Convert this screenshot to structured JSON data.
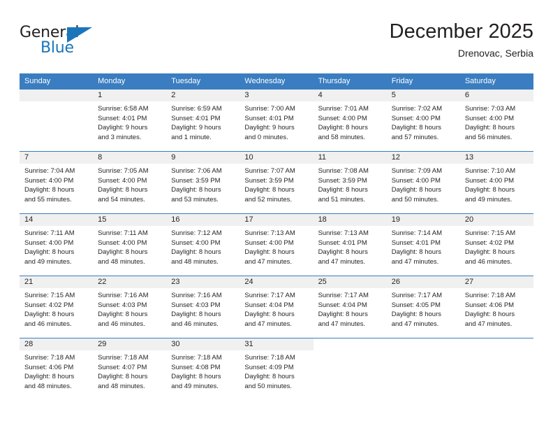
{
  "brand": {
    "name_top": "General",
    "name_bottom": "Blue",
    "accent_color": "#1b75bb",
    "flag_icon": "triangle-flag-icon"
  },
  "header": {
    "title": "December 2025",
    "subtitle": "Drenovac, Serbia"
  },
  "theme": {
    "header_row_bg": "#3a7dc0",
    "daynum_band_bg": "#f0f0f0",
    "text_color": "#231f20"
  },
  "weekdays": [
    "Sunday",
    "Monday",
    "Tuesday",
    "Wednesday",
    "Thursday",
    "Friday",
    "Saturday"
  ],
  "weeks": [
    [
      {
        "day": "",
        "empty": true,
        "sunrise": "",
        "sunset": "",
        "daylight_line1": "",
        "daylight_line2": ""
      },
      {
        "day": "1",
        "sunrise": "Sunrise: 6:58 AM",
        "sunset": "Sunset: 4:01 PM",
        "daylight_line1": "Daylight: 9 hours",
        "daylight_line2": "and 3 minutes."
      },
      {
        "day": "2",
        "sunrise": "Sunrise: 6:59 AM",
        "sunset": "Sunset: 4:01 PM",
        "daylight_line1": "Daylight: 9 hours",
        "daylight_line2": "and 1 minute."
      },
      {
        "day": "3",
        "sunrise": "Sunrise: 7:00 AM",
        "sunset": "Sunset: 4:01 PM",
        "daylight_line1": "Daylight: 9 hours",
        "daylight_line2": "and 0 minutes."
      },
      {
        "day": "4",
        "sunrise": "Sunrise: 7:01 AM",
        "sunset": "Sunset: 4:00 PM",
        "daylight_line1": "Daylight: 8 hours",
        "daylight_line2": "and 58 minutes."
      },
      {
        "day": "5",
        "sunrise": "Sunrise: 7:02 AM",
        "sunset": "Sunset: 4:00 PM",
        "daylight_line1": "Daylight: 8 hours",
        "daylight_line2": "and 57 minutes."
      },
      {
        "day": "6",
        "sunrise": "Sunrise: 7:03 AM",
        "sunset": "Sunset: 4:00 PM",
        "daylight_line1": "Daylight: 8 hours",
        "daylight_line2": "and 56 minutes."
      }
    ],
    [
      {
        "day": "7",
        "sunrise": "Sunrise: 7:04 AM",
        "sunset": "Sunset: 4:00 PM",
        "daylight_line1": "Daylight: 8 hours",
        "daylight_line2": "and 55 minutes."
      },
      {
        "day": "8",
        "sunrise": "Sunrise: 7:05 AM",
        "sunset": "Sunset: 4:00 PM",
        "daylight_line1": "Daylight: 8 hours",
        "daylight_line2": "and 54 minutes."
      },
      {
        "day": "9",
        "sunrise": "Sunrise: 7:06 AM",
        "sunset": "Sunset: 3:59 PM",
        "daylight_line1": "Daylight: 8 hours",
        "daylight_line2": "and 53 minutes."
      },
      {
        "day": "10",
        "sunrise": "Sunrise: 7:07 AM",
        "sunset": "Sunset: 3:59 PM",
        "daylight_line1": "Daylight: 8 hours",
        "daylight_line2": "and 52 minutes."
      },
      {
        "day": "11",
        "sunrise": "Sunrise: 7:08 AM",
        "sunset": "Sunset: 3:59 PM",
        "daylight_line1": "Daylight: 8 hours",
        "daylight_line2": "and 51 minutes."
      },
      {
        "day": "12",
        "sunrise": "Sunrise: 7:09 AM",
        "sunset": "Sunset: 4:00 PM",
        "daylight_line1": "Daylight: 8 hours",
        "daylight_line2": "and 50 minutes."
      },
      {
        "day": "13",
        "sunrise": "Sunrise: 7:10 AM",
        "sunset": "Sunset: 4:00 PM",
        "daylight_line1": "Daylight: 8 hours",
        "daylight_line2": "and 49 minutes."
      }
    ],
    [
      {
        "day": "14",
        "sunrise": "Sunrise: 7:11 AM",
        "sunset": "Sunset: 4:00 PM",
        "daylight_line1": "Daylight: 8 hours",
        "daylight_line2": "and 49 minutes."
      },
      {
        "day": "15",
        "sunrise": "Sunrise: 7:11 AM",
        "sunset": "Sunset: 4:00 PM",
        "daylight_line1": "Daylight: 8 hours",
        "daylight_line2": "and 48 minutes."
      },
      {
        "day": "16",
        "sunrise": "Sunrise: 7:12 AM",
        "sunset": "Sunset: 4:00 PM",
        "daylight_line1": "Daylight: 8 hours",
        "daylight_line2": "and 48 minutes."
      },
      {
        "day": "17",
        "sunrise": "Sunrise: 7:13 AM",
        "sunset": "Sunset: 4:00 PM",
        "daylight_line1": "Daylight: 8 hours",
        "daylight_line2": "and 47 minutes."
      },
      {
        "day": "18",
        "sunrise": "Sunrise: 7:13 AM",
        "sunset": "Sunset: 4:01 PM",
        "daylight_line1": "Daylight: 8 hours",
        "daylight_line2": "and 47 minutes."
      },
      {
        "day": "19",
        "sunrise": "Sunrise: 7:14 AM",
        "sunset": "Sunset: 4:01 PM",
        "daylight_line1": "Daylight: 8 hours",
        "daylight_line2": "and 47 minutes."
      },
      {
        "day": "20",
        "sunrise": "Sunrise: 7:15 AM",
        "sunset": "Sunset: 4:02 PM",
        "daylight_line1": "Daylight: 8 hours",
        "daylight_line2": "and 46 minutes."
      }
    ],
    [
      {
        "day": "21",
        "sunrise": "Sunrise: 7:15 AM",
        "sunset": "Sunset: 4:02 PM",
        "daylight_line1": "Daylight: 8 hours",
        "daylight_line2": "and 46 minutes."
      },
      {
        "day": "22",
        "sunrise": "Sunrise: 7:16 AM",
        "sunset": "Sunset: 4:03 PM",
        "daylight_line1": "Daylight: 8 hours",
        "daylight_line2": "and 46 minutes."
      },
      {
        "day": "23",
        "sunrise": "Sunrise: 7:16 AM",
        "sunset": "Sunset: 4:03 PM",
        "daylight_line1": "Daylight: 8 hours",
        "daylight_line2": "and 46 minutes."
      },
      {
        "day": "24",
        "sunrise": "Sunrise: 7:17 AM",
        "sunset": "Sunset: 4:04 PM",
        "daylight_line1": "Daylight: 8 hours",
        "daylight_line2": "and 47 minutes."
      },
      {
        "day": "25",
        "sunrise": "Sunrise: 7:17 AM",
        "sunset": "Sunset: 4:04 PM",
        "daylight_line1": "Daylight: 8 hours",
        "daylight_line2": "and 47 minutes."
      },
      {
        "day": "26",
        "sunrise": "Sunrise: 7:17 AM",
        "sunset": "Sunset: 4:05 PM",
        "daylight_line1": "Daylight: 8 hours",
        "daylight_line2": "and 47 minutes."
      },
      {
        "day": "27",
        "sunrise": "Sunrise: 7:18 AM",
        "sunset": "Sunset: 4:06 PM",
        "daylight_line1": "Daylight: 8 hours",
        "daylight_line2": "and 47 minutes."
      }
    ],
    [
      {
        "day": "28",
        "sunrise": "Sunrise: 7:18 AM",
        "sunset": "Sunset: 4:06 PM",
        "daylight_line1": "Daylight: 8 hours",
        "daylight_line2": "and 48 minutes."
      },
      {
        "day": "29",
        "sunrise": "Sunrise: 7:18 AM",
        "sunset": "Sunset: 4:07 PM",
        "daylight_line1": "Daylight: 8 hours",
        "daylight_line2": "and 48 minutes."
      },
      {
        "day": "30",
        "sunrise": "Sunrise: 7:18 AM",
        "sunset": "Sunset: 4:08 PM",
        "daylight_line1": "Daylight: 8 hours",
        "daylight_line2": "and 49 minutes."
      },
      {
        "day": "31",
        "sunrise": "Sunrise: 7:18 AM",
        "sunset": "Sunset: 4:09 PM",
        "daylight_line1": "Daylight: 8 hours",
        "daylight_line2": "and 50 minutes."
      },
      {
        "day": "",
        "blank": true,
        "sunrise": "",
        "sunset": "",
        "daylight_line1": "",
        "daylight_line2": ""
      },
      {
        "day": "",
        "blank": true,
        "sunrise": "",
        "sunset": "",
        "daylight_line1": "",
        "daylight_line2": ""
      },
      {
        "day": "",
        "blank": true,
        "sunrise": "",
        "sunset": "",
        "daylight_line1": "",
        "daylight_line2": ""
      }
    ]
  ]
}
